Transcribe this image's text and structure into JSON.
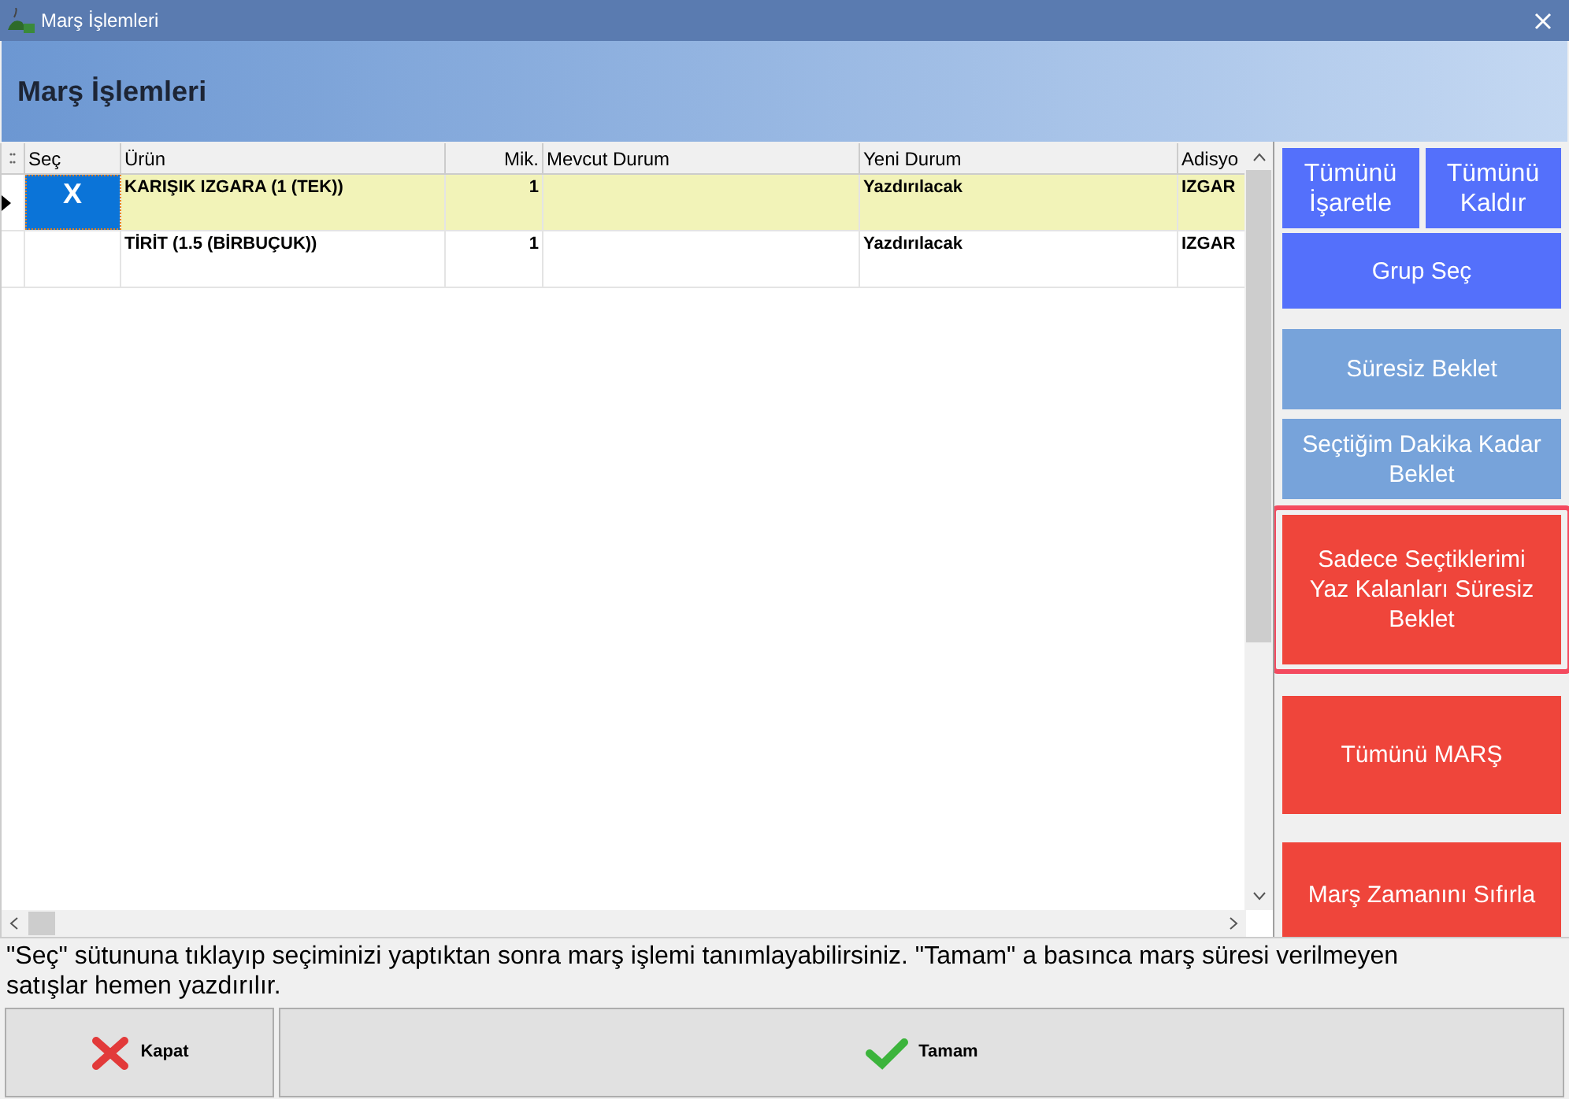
{
  "window": {
    "title": "Marş İşlemleri"
  },
  "header": {
    "title": "Marş İşlemleri"
  },
  "table": {
    "columns": [
      "Seç",
      "Ürün",
      "Mik.",
      "Mevcut Durum",
      "Yeni Durum",
      "Adisyo"
    ],
    "rows": [
      {
        "selected": true,
        "current": true,
        "mark": "X",
        "product": "KARIŞIK IZGARA (1 (TEK))",
        "qty": "1",
        "current_state": "",
        "new_state": "Yazdırılacak",
        "column_6": "IZGAR"
      },
      {
        "selected": false,
        "current": false,
        "mark": "",
        "product": "TİRİT (1.5 (BİRBUÇUK))",
        "qty": "1",
        "current_state": "",
        "new_state": "Yazdırılacak",
        "column_6": "IZGAR"
      }
    ]
  },
  "top_buttons": [
    {
      "label": "Tümünü İşaretle",
      "color": "#5470fb"
    },
    {
      "label": "Tümünü Kaldır",
      "color": "#5470fb"
    }
  ],
  "side_buttons": [
    {
      "label": "Grup Seç",
      "color": "#5470fb",
      "highlighted": false
    },
    {
      "label": "Süresiz Beklet",
      "color": "#77a3da",
      "highlighted": false
    },
    {
      "label": "Seçtiğim Dakika Kadar Beklet",
      "color": "#77a3da",
      "highlighted": false
    },
    {
      "label": "Sadece Seçtiklerimi Yaz Kalanları Süresiz Beklet",
      "color": "#ef453b",
      "highlighted": true
    },
    {
      "label": "Tümünü MARŞ",
      "color": "#ef453b",
      "highlighted": false
    },
    {
      "label": "Marş Zamanını Sıfırla",
      "color": "#ef453b",
      "highlighted": false
    }
  ],
  "hint": "\"Seç\" sütununa tıklayıp seçiminizi yaptıktan sonra marş işlemi tanımlayabilirsiniz. \"Tamam\" a basınca marş süresi verilmeyen satışlar hemen yazdırılır.",
  "footer_buttons": [
    {
      "label": "Kapat",
      "kind": "cancel"
    },
    {
      "label": "Tamam",
      "kind": "ok"
    }
  ]
}
